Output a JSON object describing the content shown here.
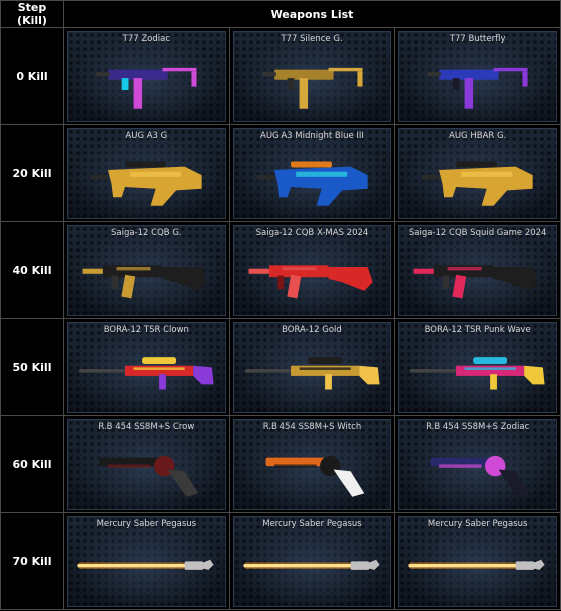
{
  "header": {
    "step_label": "Step (Kill)",
    "weapons_label": "Weapons List"
  },
  "rows": [
    {
      "step": "0 Kill",
      "weapons": [
        {
          "name": "T77 Zodiac",
          "type": "smg",
          "colors": [
            "#3a2a8c",
            "#d04ad8",
            "#18c8e8"
          ]
        },
        {
          "name": "T77 Silence G.",
          "type": "smg",
          "colors": [
            "#a8822a",
            "#d6a83c",
            "#2a2a2a"
          ]
        },
        {
          "name": "T77 Butterfly",
          "type": "smg",
          "colors": [
            "#2a3ab8",
            "#8a3ad8",
            "#1a1a2a"
          ]
        }
      ]
    },
    {
      "step": "20 Kill",
      "weapons": [
        {
          "name": "AUG A3 G",
          "type": "bullpup",
          "colors": [
            "#d8a432",
            "#f0c24a",
            "#1e1e1e"
          ]
        },
        {
          "name": "AUG A3 Midnight Blue III",
          "type": "bullpup",
          "colors": [
            "#1a5ac8",
            "#28c8e0",
            "#e07a1a"
          ]
        },
        {
          "name": "AUG HBAR G.",
          "type": "bullpup",
          "colors": [
            "#d8a432",
            "#f0c24a",
            "#1e1e1e"
          ]
        }
      ]
    },
    {
      "step": "40 Kill",
      "weapons": [
        {
          "name": "Saiga-12 CQB G.",
          "type": "shotgun",
          "colors": [
            "#1e1e1e",
            "#c89a32",
            "#303030"
          ]
        },
        {
          "name": "Saiga-12 CQB X-MAS 2024",
          "type": "shotgun",
          "colors": [
            "#d82828",
            "#e85050",
            "#7a1414"
          ]
        },
        {
          "name": "Saiga-12 CQB Squid Game 2024",
          "type": "shotgun",
          "colors": [
            "#1e1e1e",
            "#e0285a",
            "#303030"
          ]
        }
      ]
    },
    {
      "step": "50 Kill",
      "weapons": [
        {
          "name": "BORA-12 TSR Clown",
          "type": "sniper",
          "colors": [
            "#d82828",
            "#8a3ad8",
            "#f0c83a"
          ]
        },
        {
          "name": "BORA-12 Gold",
          "type": "sniper",
          "colors": [
            "#c89a32",
            "#f0c24a",
            "#1e1e1e"
          ]
        },
        {
          "name": "BORA-12 TSR Punk Wave",
          "type": "sniper",
          "colors": [
            "#d82878",
            "#f0c83a",
            "#28b8e0"
          ]
        }
      ]
    },
    {
      "step": "60 Kill",
      "weapons": [
        {
          "name": "R.B 454 SS8M+S Crow",
          "type": "revolver",
          "colors": [
            "#1a1a1a",
            "#6a1a1a",
            "#3a3a3a"
          ]
        },
        {
          "name": "R.B 454 SS8M+S Witch",
          "type": "revolver",
          "colors": [
            "#e0681a",
            "#1a1a1a",
            "#f0f0f0"
          ]
        },
        {
          "name": "R.B 454 SS8M+S Zodiac",
          "type": "revolver",
          "colors": [
            "#2a2a6a",
            "#d04ad8",
            "#1a1a2a"
          ]
        }
      ]
    },
    {
      "step": "70 Kill",
      "weapons": [
        {
          "name": "Mercury Saber Pegasus",
          "type": "saber",
          "colors": [
            "#ff9a1a",
            "#ffe08a",
            "#c0c0c0"
          ]
        },
        {
          "name": "Mercury Saber Pegasus",
          "type": "saber",
          "colors": [
            "#ff9a1a",
            "#ffe08a",
            "#c0c0c0"
          ]
        },
        {
          "name": "Mercury Saber Pegasus",
          "type": "saber",
          "colors": [
            "#ff9a1a",
            "#ffe08a",
            "#c0c0c0"
          ]
        }
      ]
    }
  ]
}
